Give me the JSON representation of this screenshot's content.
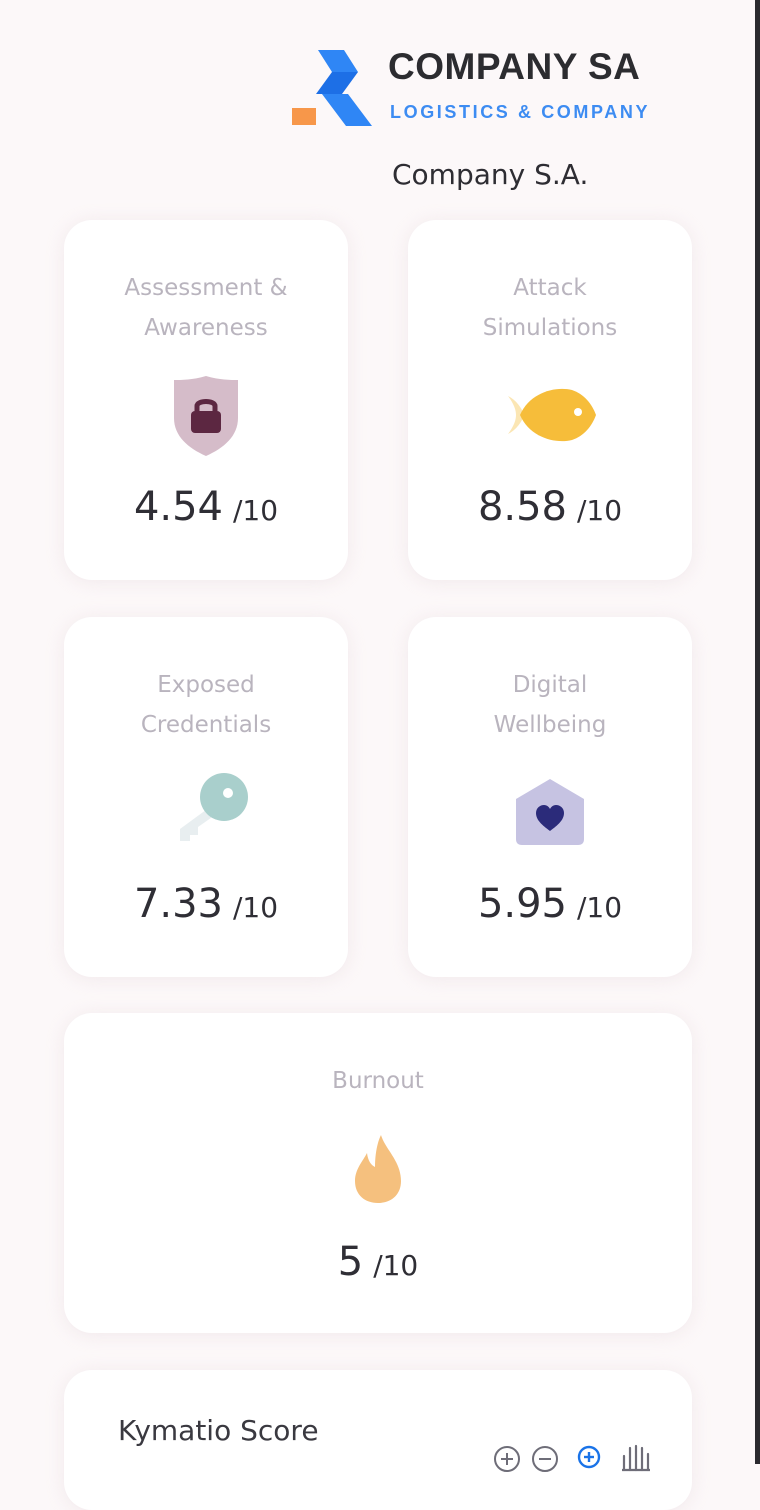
{
  "header": {
    "logo": {
      "title": "COMPANY SA",
      "subtitle": "LOGISTICS & COMPANY"
    },
    "company_name": "Company S.A."
  },
  "cards": [
    {
      "title_line1": "Assessment &",
      "title_line2": "Awareness",
      "icon": "shield-lock-icon",
      "score": "4.54",
      "denominator": "/10",
      "icon_color": "#d5bcc9"
    },
    {
      "title_line1": "Attack",
      "title_line2": "Simulations",
      "icon": "fish-icon",
      "score": "8.58",
      "denominator": "/10",
      "icon_color": "#f6bd3a"
    },
    {
      "title_line1": "Exposed",
      "title_line2": "Credentials",
      "icon": "key-icon",
      "score": "7.33",
      "denominator": "/10",
      "icon_color": "#a9cfcc"
    },
    {
      "title_line1": "Digital",
      "title_line2": "Wellbeing",
      "icon": "house-heart-icon",
      "score": "5.95",
      "denominator": "/10",
      "icon_color": "#c6c3e2"
    },
    {
      "title_line1": "Burnout",
      "icon": "flame-icon",
      "score": "5",
      "denominator": "/10",
      "icon_color": "#f5c07e"
    }
  ],
  "kymatio": {
    "title": "Kymatio Score",
    "toolbar_icons": [
      "zoom-in-icon",
      "zoom-out-icon",
      "reset-zoom-icon",
      "pan-hand-icon"
    ],
    "active_color": "#1a73e8"
  }
}
